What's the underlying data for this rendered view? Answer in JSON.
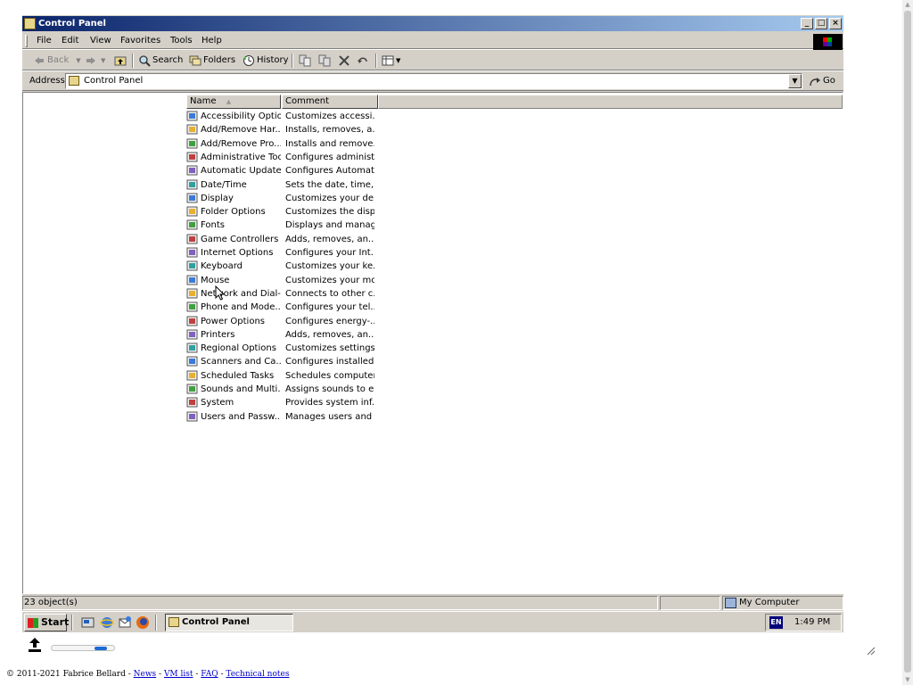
{
  "window": {
    "title": "Control Panel",
    "buttons": [
      "_",
      "□",
      "×"
    ]
  },
  "menubar": {
    "items": [
      "File",
      "Edit",
      "View",
      "Favorites",
      "Tools",
      "Help"
    ]
  },
  "toolbar": {
    "back": "Back",
    "search": "Search",
    "folders": "Folders",
    "history": "History"
  },
  "address": {
    "label": "Address",
    "value": "Control Panel",
    "go": "Go"
  },
  "list": {
    "columns": [
      "Name",
      "Comment"
    ],
    "rows": [
      {
        "name": "Accessibility Options",
        "comment": "Customizes accessi...",
        "icon": "accessibility-icon"
      },
      {
        "name": "Add/Remove Har...",
        "comment": "Installs, removes, a...",
        "icon": "add-hardware-icon"
      },
      {
        "name": "Add/Remove Pro...",
        "comment": "Installs and remove...",
        "icon": "add-programs-icon"
      },
      {
        "name": "Administrative Tools",
        "comment": "Configures administ...",
        "icon": "admin-tools-icon"
      },
      {
        "name": "Automatic Updates",
        "comment": "Configures Automat...",
        "icon": "updates-icon"
      },
      {
        "name": "Date/Time",
        "comment": "Sets the date, time,...",
        "icon": "datetime-icon"
      },
      {
        "name": "Display",
        "comment": "Customizes your de...",
        "icon": "display-icon"
      },
      {
        "name": "Folder Options",
        "comment": "Customizes the disp...",
        "icon": "folder-options-icon"
      },
      {
        "name": "Fonts",
        "comment": "Displays and manag...",
        "icon": "fonts-icon"
      },
      {
        "name": "Game Controllers",
        "comment": "Adds, removes, an...",
        "icon": "game-controllers-icon"
      },
      {
        "name": "Internet Options",
        "comment": "Configures your Int...",
        "icon": "internet-options-icon"
      },
      {
        "name": "Keyboard",
        "comment": "Customizes your ke...",
        "icon": "keyboard-icon"
      },
      {
        "name": "Mouse",
        "comment": "Customizes your mo...",
        "icon": "mouse-icon"
      },
      {
        "name": "Network and Dial-...",
        "comment": "Connects to other c...",
        "icon": "network-icon"
      },
      {
        "name": "Phone and Mode...",
        "comment": "Configures your tel...",
        "icon": "phone-modem-icon"
      },
      {
        "name": "Power Options",
        "comment": "Configures energy-...",
        "icon": "power-icon"
      },
      {
        "name": "Printers",
        "comment": "Adds, removes, an...",
        "icon": "printers-icon"
      },
      {
        "name": "Regional Options",
        "comment": "Customizes settings...",
        "icon": "regional-icon"
      },
      {
        "name": "Scanners and Ca...",
        "comment": "Configures installed...",
        "icon": "scanners-icon"
      },
      {
        "name": "Scheduled Tasks",
        "comment": "Schedules computer...",
        "icon": "scheduled-tasks-icon"
      },
      {
        "name": "Sounds and Multi...",
        "comment": "Assigns sounds to e...",
        "icon": "sounds-icon"
      },
      {
        "name": "System",
        "comment": "Provides system inf...",
        "icon": "system-icon"
      },
      {
        "name": "Users and Passw...",
        "comment": "Manages users and ...",
        "icon": "users-icon"
      }
    ]
  },
  "statusbar": {
    "objects": "23 object(s)",
    "zone": "My Computer"
  },
  "taskbar": {
    "start": "Start",
    "task": "Control Panel",
    "lang": "EN",
    "clock": "1:49 PM"
  },
  "footer": {
    "copyright": "© 2011-2021 Fabrice Bellard - ",
    "links": [
      "News",
      "VM list",
      "FAQ",
      "Technical notes"
    ],
    "sep": " - "
  },
  "colors": {
    "title_start": "#0a246a",
    "title_end": "#a6caf0",
    "face": "#d4d0c8",
    "link": "#0000cc"
  }
}
